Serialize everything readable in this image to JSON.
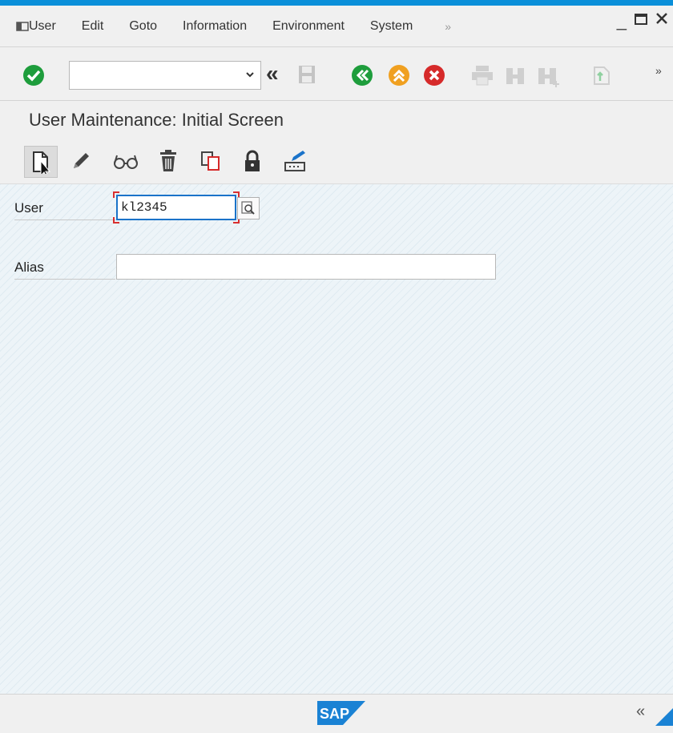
{
  "menu": {
    "items": [
      {
        "label": "User"
      },
      {
        "label": "Edit"
      },
      {
        "label": "Goto"
      },
      {
        "label": "Information"
      },
      {
        "label": "Environment"
      },
      {
        "label": "System"
      }
    ],
    "more": "»"
  },
  "window_controls": {
    "minimize": "_"
  },
  "toolbar": {
    "command_field_value": "",
    "collapse": "«",
    "more": "»"
  },
  "page": {
    "title": "User Maintenance: Initial Screen"
  },
  "form": {
    "user_label": "User",
    "user_value": "kl2345",
    "alias_label": "Alias",
    "alias_value": ""
  },
  "status": {
    "logo": "SAP",
    "collapse": "«"
  },
  "colors": {
    "accent_blue": "#0a8fd9",
    "ok_green": "#1e9d3c",
    "nav_orange": "#f0a020",
    "cancel_red": "#d62a2a",
    "focus_blue": "#1a73c9",
    "required_red": "#d83030"
  },
  "icons": {
    "menu_toggle": "menu-toggle-icon",
    "enter": "checkmark-icon",
    "save": "save-icon",
    "back": "back-icon",
    "exit": "exit-icon",
    "cancel": "cancel-icon",
    "print": "print-icon",
    "find": "find-icon",
    "find_next": "find-next-icon",
    "create_session": "create-session-icon",
    "create": "create-icon",
    "change": "pencil-icon",
    "display": "glasses-icon",
    "delete": "trash-icon",
    "copy": "copy-icon",
    "lock": "lock-icon",
    "change_password": "change-password-icon",
    "search_help": "search-help-icon"
  }
}
